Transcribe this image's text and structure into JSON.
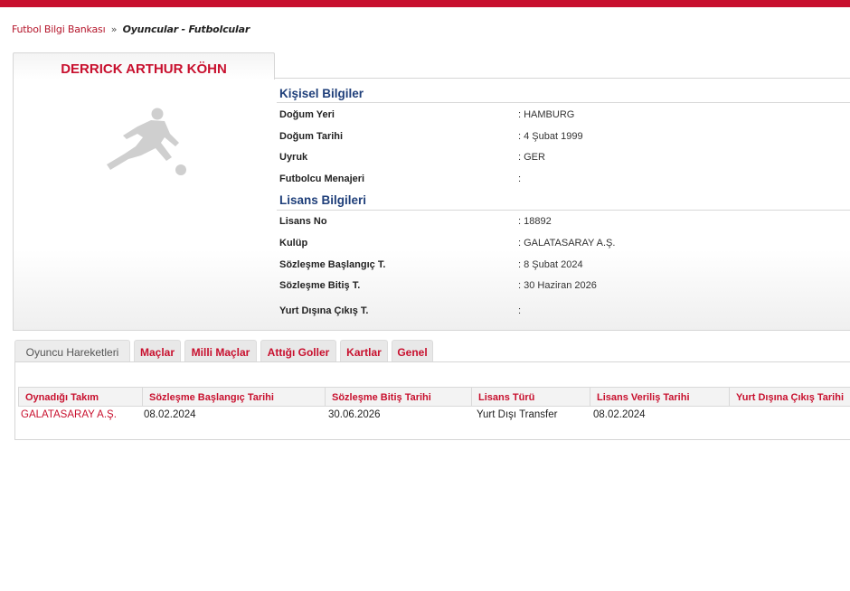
{
  "breadcrumb": {
    "root": "Futbol Bilgi Bankası",
    "separator": "»",
    "current": "Oyuncular - Futbolcular"
  },
  "player": {
    "name": "DERRICK ARTHUR KÖHN"
  },
  "personal": {
    "title": "Kişisel Bilgiler",
    "rows": [
      {
        "label": "Doğum Yeri",
        "value": ":  HAMBURG"
      },
      {
        "label": "Doğum Tarihi",
        "value": ":  4 Şubat 1999"
      },
      {
        "label": "Uyruk",
        "value": ":  GER"
      },
      {
        "label": "Futbolcu Menajeri",
        "value": ":"
      }
    ]
  },
  "license": {
    "title": "Lisans Bilgileri",
    "rows": [
      {
        "label": "Lisans No",
        "value": ": 18892"
      },
      {
        "label": "Kulüp",
        "value": ": GALATASARAY A.Ş."
      },
      {
        "label": "Sözleşme Başlangıç T.",
        "value": ": 8 Şubat 2024"
      },
      {
        "label": "Sözleşme Bitiş T.",
        "value": ": 30 Haziran 2026"
      },
      {
        "label": "Yurt Dışına Çıkış T.",
        "value": ":"
      }
    ]
  },
  "tabs": [
    "Oyuncu Hareketleri",
    "Maçlar",
    "Milli Maçlar",
    "Attığı Goller",
    "Kartlar",
    "Genel"
  ],
  "movements": {
    "columns": [
      "Oynadığı Takım",
      "Sözleşme Başlangıç Tarihi",
      "Sözleşme Bitiş Tarihi",
      "Lisans Türü",
      "Lisans Veriliş Tarihi",
      "Yurt Dışına Çıkış Tarihi"
    ],
    "rows": [
      [
        "GALATASARAY A.Ş.",
        "08.02.2024",
        "30.06.2026",
        "Yurt Dışı Transfer",
        "08.02.2024",
        ""
      ]
    ]
  },
  "colors": {
    "brand_red": "#c8102e",
    "section_blue": "#1f3f7a"
  },
  "icons": {
    "player_photo": "player-silhouette-icon"
  }
}
